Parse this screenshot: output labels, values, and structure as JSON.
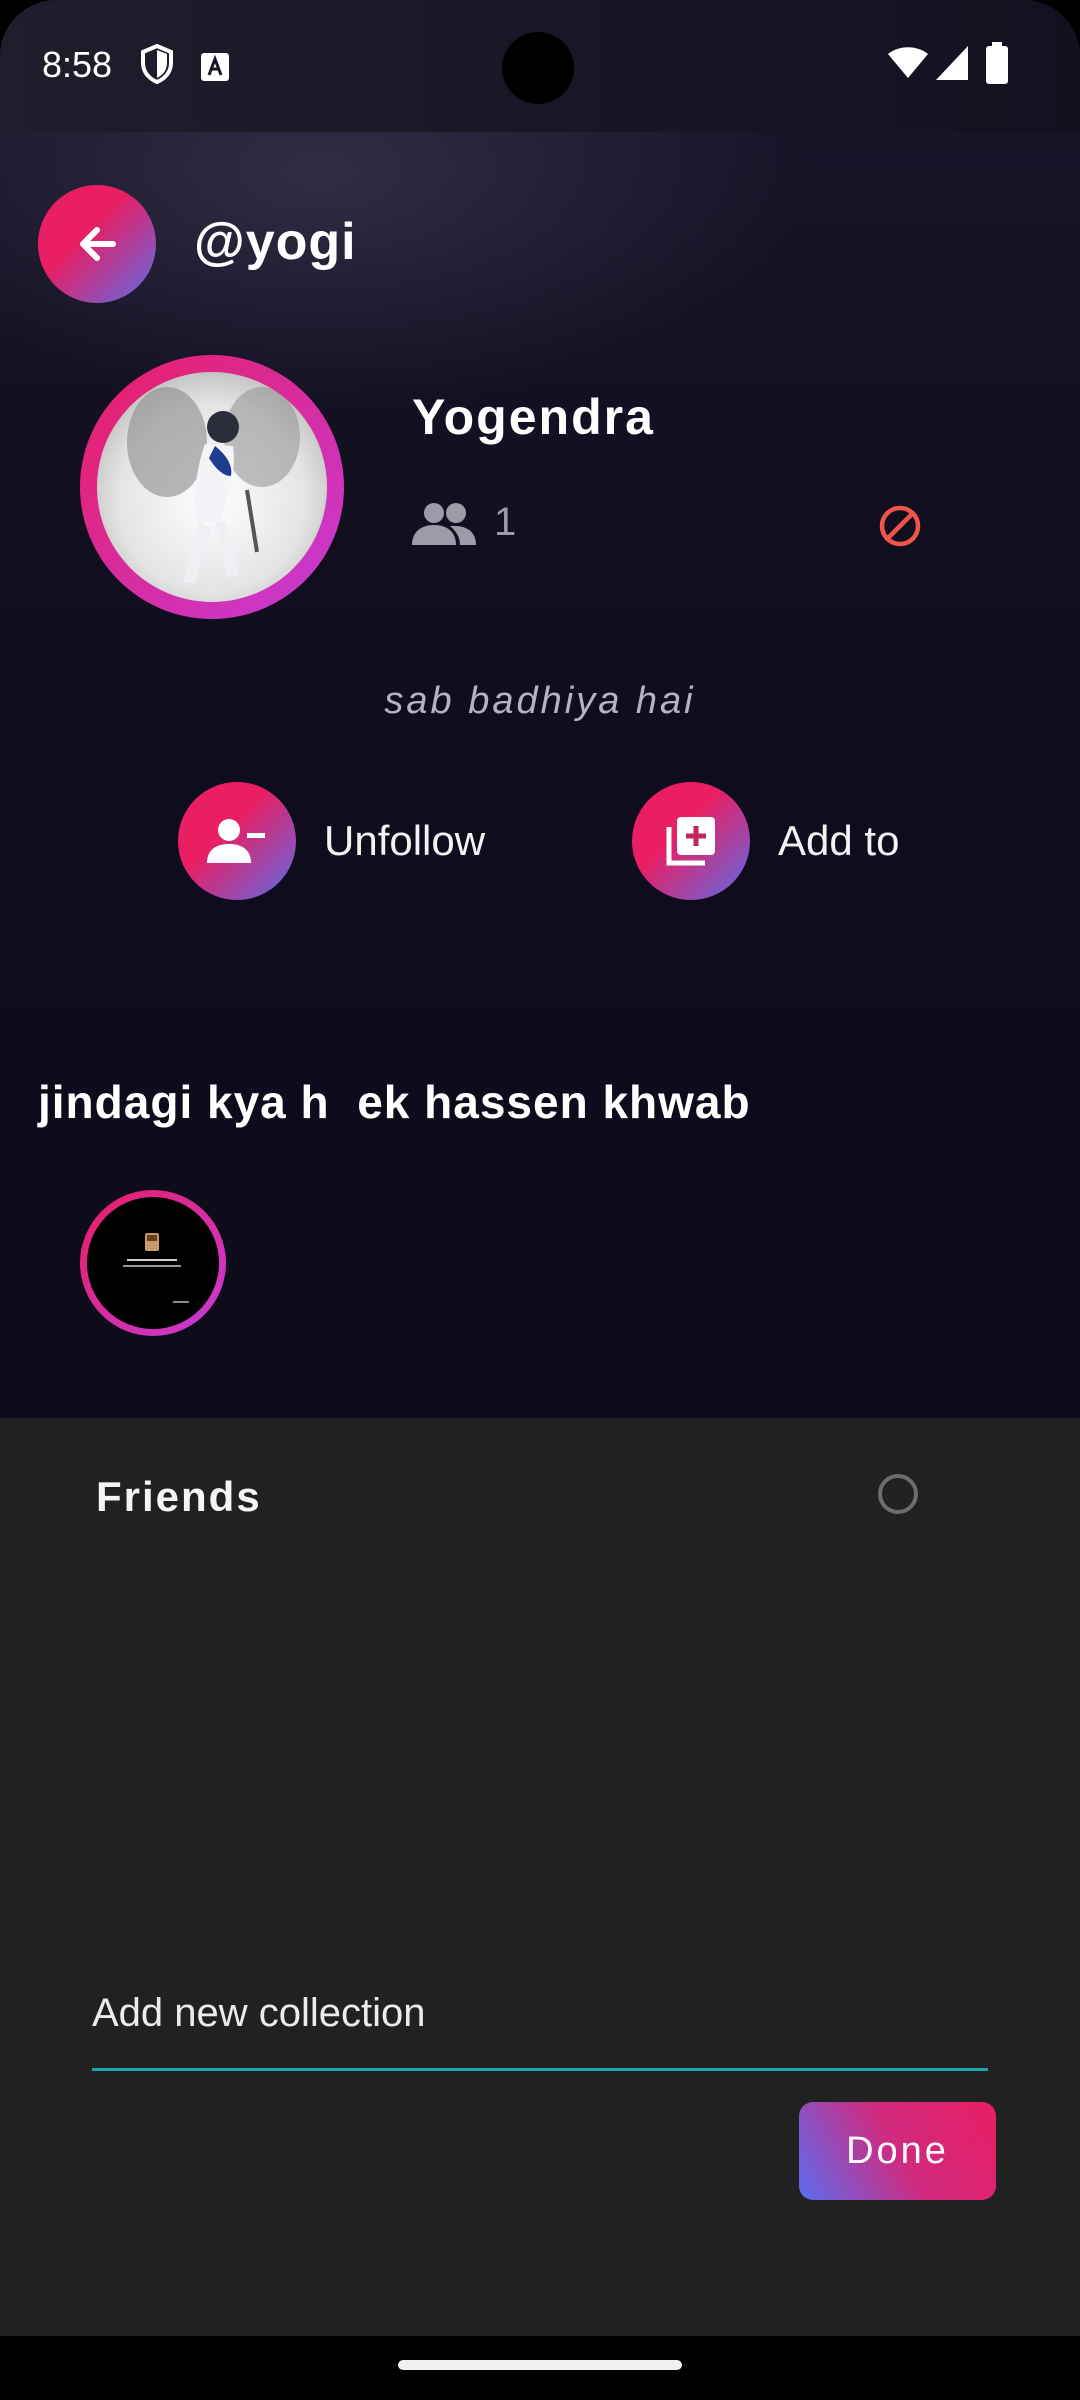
{
  "status_bar": {
    "time": "8:58",
    "icons": [
      "shield-icon",
      "font-notification-icon",
      "wifi-icon",
      "signal-icon",
      "battery-icon"
    ]
  },
  "header": {
    "back_icon": "arrow-left-icon",
    "handle": "@yogi"
  },
  "profile": {
    "display_name": "Yogendra",
    "friends_icon": "people-icon",
    "friends_count": "1",
    "block_icon": "block-icon",
    "bio": "sab badhiya hai"
  },
  "actions": {
    "unfollow_label": "Unfollow",
    "unfollow_icon": "person-remove-icon",
    "add_to_label": "Add to",
    "add_to_icon": "library-add-icon"
  },
  "collection": {
    "title": "jindagi kya h  ek hassen khwab"
  },
  "sheet": {
    "items": [
      {
        "label": "Friends",
        "selected": false
      }
    ],
    "new_collection_placeholder": "Add new collection",
    "done_label": "Done"
  },
  "colors": {
    "accent_pink": "#e91e63",
    "accent_blue": "#5a6de8",
    "input_underline": "#1fa3b3",
    "block_red": "#f0554a",
    "sheet_bg": "#212121"
  }
}
